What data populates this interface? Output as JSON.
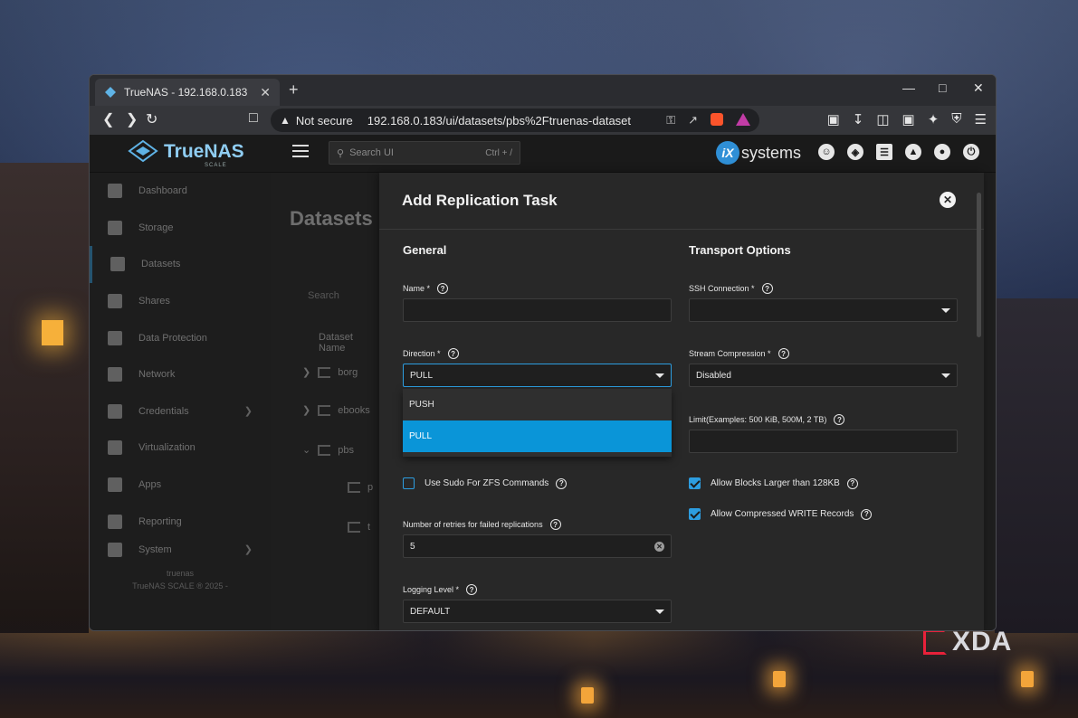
{
  "browser": {
    "tab_title": "TrueNAS - 192.168.0.183",
    "tab_close": "✕",
    "new_tab": "+",
    "not_secure": "Not secure",
    "url": "192.168.0.183/ui/datasets/pbs%2Ftruenas-dataset"
  },
  "app": {
    "logo_text": "TrueNAS",
    "logo_sub": "SCALE",
    "search_placeholder": "Search UI",
    "search_shortcut": "Ctrl + /",
    "vendor": "systems",
    "vendor_badge": "iX"
  },
  "sidebar": {
    "items": [
      {
        "label": "Dashboard"
      },
      {
        "label": "Storage"
      },
      {
        "label": "Datasets"
      },
      {
        "label": "Shares"
      },
      {
        "label": "Data Protection"
      },
      {
        "label": "Network"
      },
      {
        "label": "Credentials"
      },
      {
        "label": "Virtualization"
      },
      {
        "label": "Apps"
      },
      {
        "label": "Reporting"
      },
      {
        "label": "System"
      }
    ],
    "footer_1": "truenas",
    "footer_2": "TrueNAS SCALE ® 2025 -"
  },
  "background_page": {
    "title": "Datasets",
    "search": "Search",
    "header": "Dataset Name",
    "rows": [
      "borg",
      "ebooks",
      "pbs",
      "p",
      "t"
    ]
  },
  "modal": {
    "title": "Add Replication Task",
    "general_heading": "General",
    "transport_heading": "Transport Options",
    "name_label": "Name *",
    "name_value": "",
    "direction_label": "Direction *",
    "direction_value": "PULL",
    "direction_options": [
      "PUSH",
      "PULL"
    ],
    "direction_selected": "PULL",
    "sudo_label": "Use Sudo For ZFS Commands",
    "retries_label": "Number of retries for failed replications",
    "retries_value": "5",
    "logging_label": "Logging Level *",
    "logging_value": "DEFAULT",
    "ssh_label": "SSH Connection *",
    "ssh_value": "",
    "compression_label": "Stream Compression *",
    "compression_value": "Disabled",
    "limit_label": "Limit(Examples: 500 KiB, 500M, 2 TB)",
    "limit_value": "",
    "large_blocks_label": "Allow Blocks Larger than 128KB",
    "large_blocks_checked": true,
    "compressed_label": "Allow Compressed WRITE Records",
    "compressed_checked": true,
    "sudo_checked": false
  },
  "watermark": "XDA",
  "colors": {
    "accent": "#0a95d8",
    "modal_bg": "#282828",
    "page_bg": "#1e1e1e"
  }
}
